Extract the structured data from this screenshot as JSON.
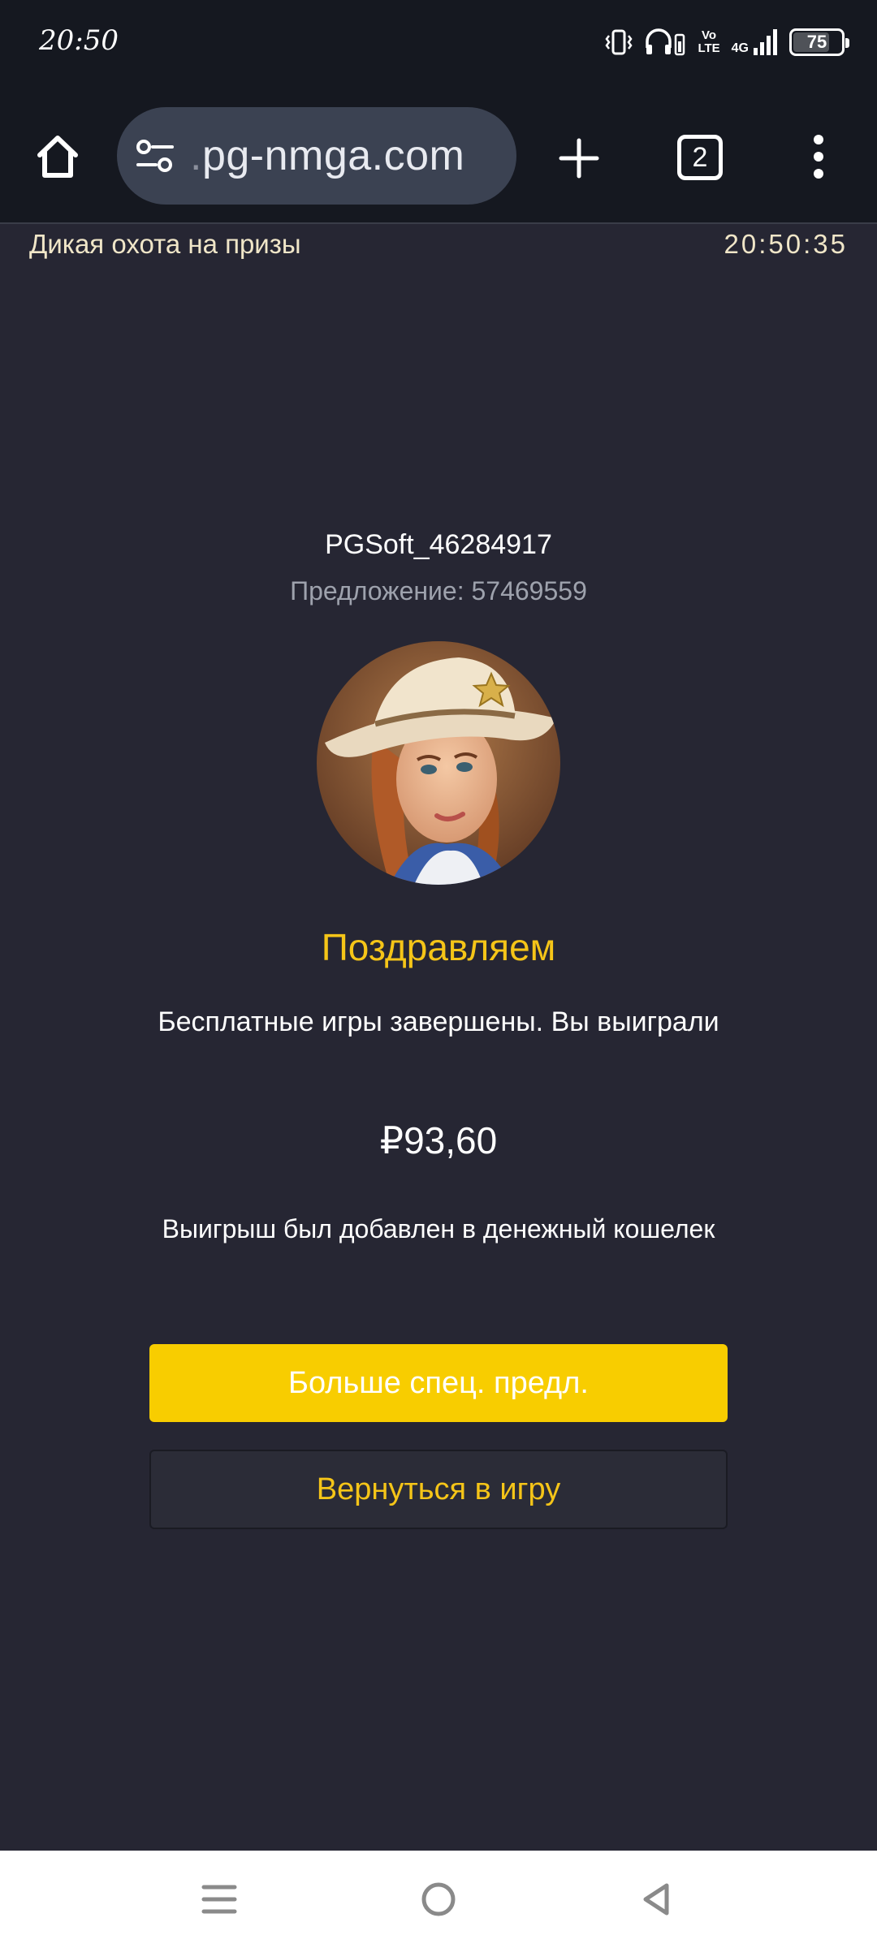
{
  "status_bar": {
    "time": "20:50",
    "network_top": "Vo",
    "network_bottom": "LTE",
    "signal_label": "4G",
    "battery": "75",
    "battery_level_percent": 75
  },
  "browser": {
    "url": "pg-nmga.com",
    "url_prefix_faded": ".",
    "tab_count": "2"
  },
  "header": {
    "game_name": "Дикая охота на призы",
    "clock": "20:50:35"
  },
  "result": {
    "player_id": "PGSoft_46284917",
    "offer": "Предложение: 57469559",
    "congrats": "Поздравляем",
    "message": "Бесплатные игры завершены. Вы выиграли",
    "amount": "₽93,60",
    "wallet_note": "Выигрыш был добавлен в денежный кошелек"
  },
  "buttons": {
    "more_offers": "Больше спец. предл.",
    "back_to_game": "Вернуться в игру"
  },
  "colors": {
    "accent": "#f8cd00",
    "background": "#262633",
    "toolbar": "#151820"
  }
}
